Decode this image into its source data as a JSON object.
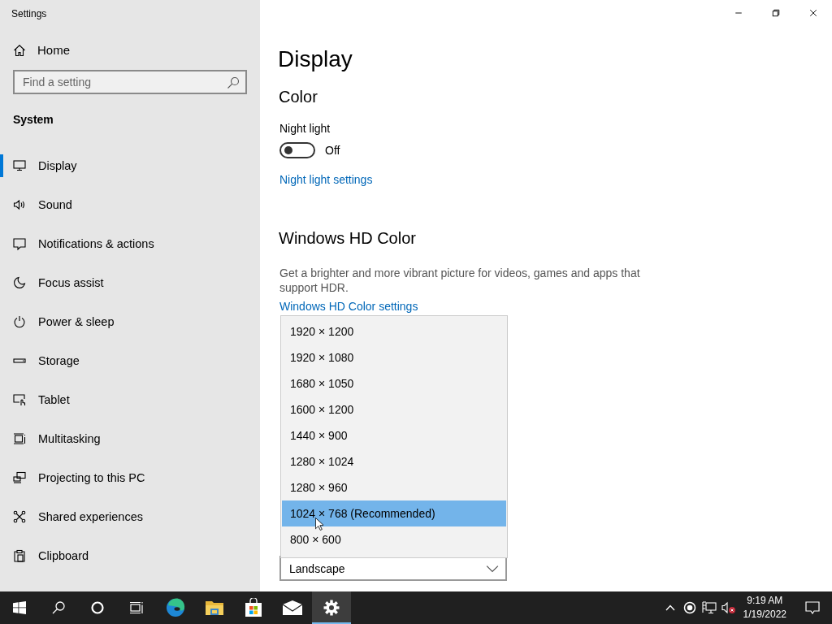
{
  "window": {
    "title": "Settings"
  },
  "sidebar": {
    "home": "Home",
    "search": {
      "placeholder": "Find a setting"
    },
    "section": "System",
    "items": [
      {
        "label": "Display",
        "selected": true
      },
      {
        "label": "Sound",
        "selected": false
      },
      {
        "label": "Notifications & actions",
        "selected": false
      },
      {
        "label": "Focus assist",
        "selected": false
      },
      {
        "label": "Power & sleep",
        "selected": false
      },
      {
        "label": "Storage",
        "selected": false
      },
      {
        "label": "Tablet",
        "selected": false
      },
      {
        "label": "Multitasking",
        "selected": false
      },
      {
        "label": "Projecting to this PC",
        "selected": false
      },
      {
        "label": "Shared experiences",
        "selected": false
      },
      {
        "label": "Clipboard",
        "selected": false
      }
    ]
  },
  "main": {
    "title": "Display",
    "color_heading": "Color",
    "night_light": {
      "label": "Night light",
      "on": false,
      "state_text": "Off"
    },
    "night_light_link": "Night light settings",
    "hd_heading": "Windows HD Color",
    "hd_description": "Get a brighter and more vibrant picture for videos, games and apps that support HDR.",
    "hd_link": "Windows HD Color settings",
    "resolution_dropdown": {
      "open": true,
      "options": [
        {
          "label": "1920 × 1200",
          "selected": false
        },
        {
          "label": "1920 × 1080",
          "selected": false
        },
        {
          "label": "1680 × 1050",
          "selected": false
        },
        {
          "label": "1600 × 1200",
          "selected": false
        },
        {
          "label": "1440 × 900",
          "selected": false
        },
        {
          "label": "1280 × 1024",
          "selected": false
        },
        {
          "label": "1280 × 960",
          "selected": false
        },
        {
          "label": "1024 × 768 (Recommended)",
          "selected": true
        },
        {
          "label": "800 × 600",
          "selected": false
        }
      ]
    },
    "orientation": {
      "value": "Landscape"
    }
  },
  "taskbar": {
    "apps": [
      {
        "kind": "start",
        "selected": false
      },
      {
        "kind": "search",
        "selected": false
      },
      {
        "kind": "cortana",
        "selected": false
      },
      {
        "kind": "taskview",
        "selected": false
      },
      {
        "kind": "edge",
        "selected": false
      },
      {
        "kind": "explorer",
        "selected": false
      },
      {
        "kind": "store",
        "selected": false
      },
      {
        "kind": "mail",
        "selected": false
      },
      {
        "kind": "settings",
        "selected": true
      }
    ],
    "time": "9:19 AM",
    "date": "1/19/2022"
  }
}
